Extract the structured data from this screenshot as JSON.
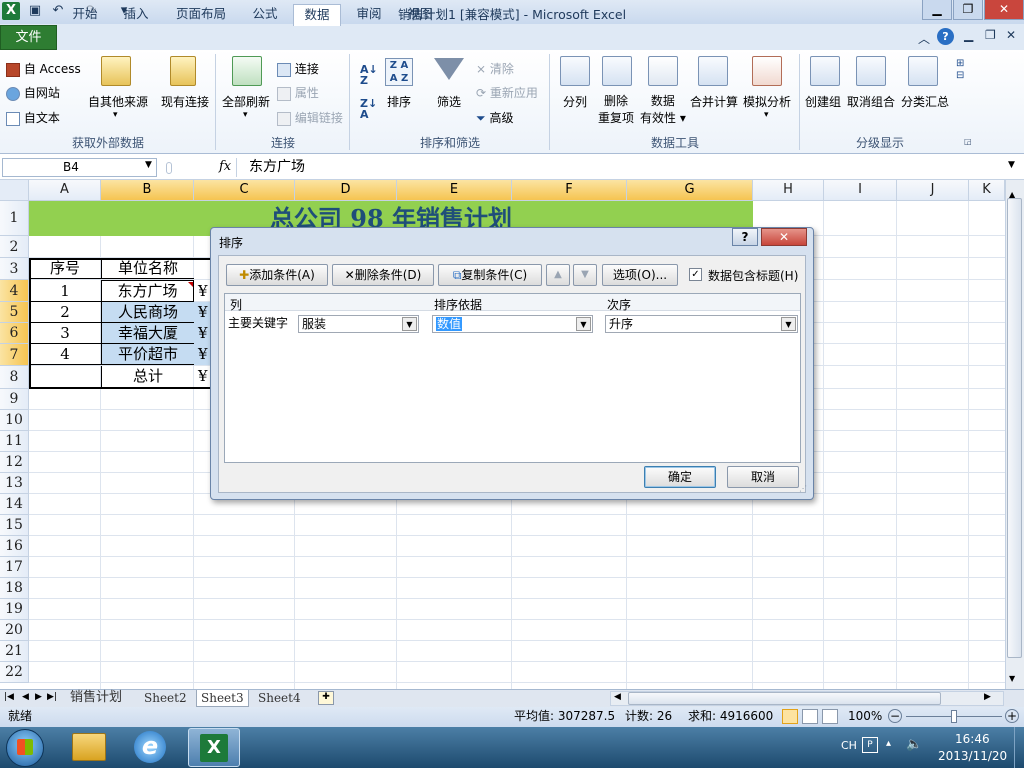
{
  "window": {
    "title": "销售计划1  [兼容模式] - Microsoft Excel",
    "app_icon": "X"
  },
  "ribbon_tabs": [
    "文件",
    "开始",
    "插入",
    "页面布局",
    "公式",
    "数据",
    "审阅",
    "视图"
  ],
  "active_tab": "数据",
  "ribbon": {
    "group_external": {
      "label": "获取外部数据",
      "from_access": "自 Access",
      "from_web": "自网站",
      "from_text": "自文本",
      "other_sources": "自其他来源",
      "existing_connections": "现有连接"
    },
    "group_connections": {
      "label": "连接",
      "refresh_all": "全部刷新",
      "connections": "连接",
      "properties": "属性",
      "edit_links": "编辑链接"
    },
    "group_sort_filter": {
      "label": "排序和筛选",
      "sort": "排序",
      "filter": "筛选",
      "clear": "清除",
      "reapply": "重新应用",
      "advanced": "高级"
    },
    "group_data_tools": {
      "label": "数据工具",
      "text_to_columns": "分列",
      "remove_dup_1": "删除",
      "remove_dup_2": "重复项",
      "validation_1": "数据",
      "validation_2": "有效性",
      "consolidate": "合并计算",
      "what_if": "模拟分析"
    },
    "group_outline": {
      "label": "分级显示",
      "group": "创建组",
      "ungroup": "取消组合",
      "subtotal": "分类汇总"
    }
  },
  "formula_bar": {
    "name_box": "B4",
    "fx": "fx",
    "content": "东方广场"
  },
  "columns": [
    "A",
    "B",
    "C",
    "D",
    "E",
    "F",
    "G",
    "H",
    "I",
    "J",
    "K"
  ],
  "rows": [
    "1",
    "2",
    "3",
    "4",
    "5",
    "6",
    "7",
    "8",
    "9",
    "10",
    "11",
    "12",
    "13",
    "14",
    "15",
    "16",
    "17",
    "18",
    "19",
    "20",
    "21",
    "22"
  ],
  "sheet": {
    "title": "总公司 98 年销售计划",
    "header_no": "序号",
    "header_name": "单位名称",
    "rows": [
      {
        "no": "1",
        "name": "东方广场",
        "c": "¥"
      },
      {
        "no": "2",
        "name": "人民商场",
        "c": "¥"
      },
      {
        "no": "3",
        "name": "幸福大厦",
        "c": "¥"
      },
      {
        "no": "4",
        "name": "平价超市",
        "c": "¥"
      }
    ],
    "total_label": "总计",
    "total_c": "¥"
  },
  "sort_dialog": {
    "title": "排序",
    "help": "?",
    "close": "✕",
    "add_level": "添加条件(A)",
    "delete_level": "删除条件(D)",
    "copy_level": "复制条件(C)",
    "move_up": "▲",
    "move_down": "▼",
    "options": "选项(O)...",
    "has_headers_label": "数据包含标题(H)",
    "has_headers_checked": true,
    "col_header": "列",
    "basis_header": "排序依据",
    "order_header": "次序",
    "sort_by_label": "主要关键字",
    "sort_by_value": "服装",
    "sort_on_value": "数值",
    "order_value": "升序",
    "ok": "确定",
    "cancel": "取消"
  },
  "sheet_tabs": [
    "销售计划",
    "Sheet2",
    "Sheet3",
    "Sheet4"
  ],
  "active_sheet": "Sheet3",
  "status": {
    "ready": "就绪",
    "average": "平均值: 307287.5",
    "count": "计数: 26",
    "sum": "求和: 4916600",
    "zoom": "100%"
  },
  "taskbar": {
    "lang": "CH",
    "time": "16:46",
    "date": "2013/11/20"
  },
  "colors": {
    "title_fill": "#92d050",
    "selected_fill": "#c5dcf2",
    "header_highlight": "#f5c451",
    "file_tab": "#2e7d32"
  }
}
